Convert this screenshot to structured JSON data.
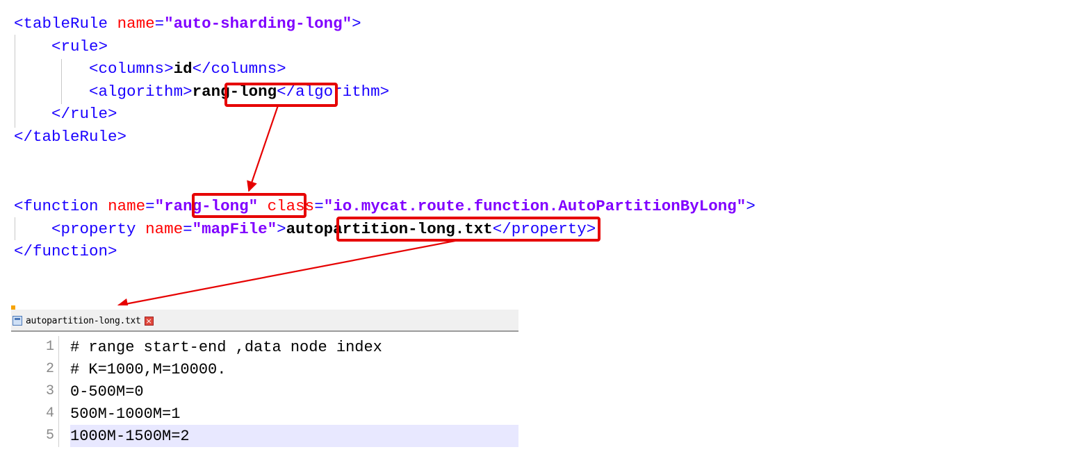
{
  "xml_rule": {
    "tableRule_tag": "tableRule",
    "name_attr": "name",
    "name_value": "\"auto-sharding-long\"",
    "rule_tag": "rule",
    "columns_tag": "columns",
    "columns_value": "id",
    "algorithm_tag": "algorithm",
    "algorithm_value": "rang-long"
  },
  "xml_function": {
    "function_tag": "function",
    "name_attr": "name",
    "name_value": "rang-long",
    "class_attr": "class",
    "class_value": "\"io.mycat.route.function.AutoPartitionByLong\"",
    "property_tag": "property",
    "property_name_value": "\"mapFile\"",
    "property_value": "autopartition-long.txt"
  },
  "editor": {
    "file_icon": "file-icon",
    "tab_label": "autopartition-long.txt",
    "close_icon": "close-icon",
    "lines": [
      {
        "number": "1",
        "text": "# range start-end ,data node index"
      },
      {
        "number": "2",
        "text": "# K=1000,M=10000."
      },
      {
        "number": "3",
        "text": "0-500M=0"
      },
      {
        "number": "4",
        "text": "500M-1000M=1"
      },
      {
        "number": "5",
        "text": "1000M-1500M=2"
      }
    ]
  },
  "colors": {
    "tag": "#1a00ff",
    "attribute": "#ff0000",
    "value": "#8000ff",
    "highlight_box": "#e60000",
    "current_line": "#e8e8ff"
  }
}
